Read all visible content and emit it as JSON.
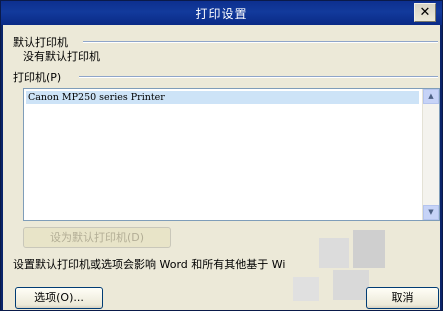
{
  "window": {
    "title": "打印设置"
  },
  "title_controls": {
    "close_glyph": "✕"
  },
  "default_printer": {
    "group_label": "默认打印机",
    "value": "没有默认打印机"
  },
  "printers": {
    "group_label": "打印机(P)",
    "items": [
      "Canon MP250 series Printer"
    ],
    "selected_index": 0
  },
  "scroll": {
    "up_glyph": "▲",
    "down_glyph": "▼"
  },
  "buttons": {
    "set_default": "设为默认打印机(D)",
    "options": "选项(O)...",
    "cancel": "取消"
  },
  "info_text": "设置默认打印机或选项会影响 Word 和所有其他基于 Wi"
}
